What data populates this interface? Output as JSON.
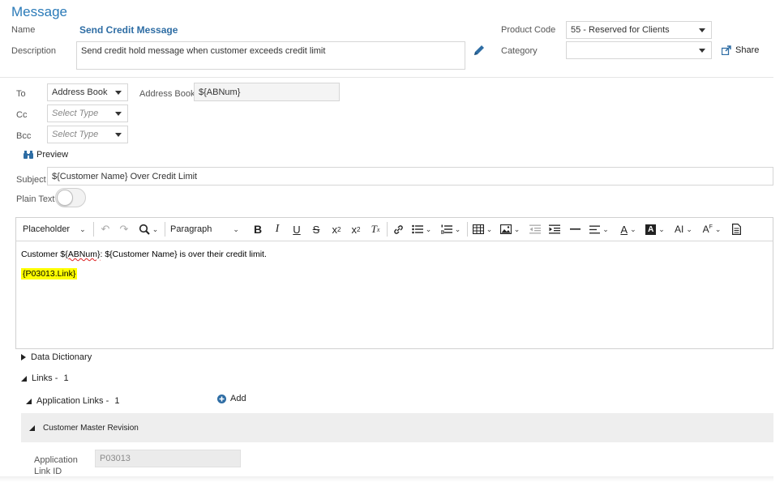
{
  "page": {
    "title": "Message",
    "accent": "#2a7ab8",
    "link_color": "#2e6da4"
  },
  "header": {
    "name_label": "Name",
    "name_value": "Send Credit Message",
    "description_label": "Description",
    "description_value": "Send credit hold message when customer exceeds credit limit",
    "product_code_label": "Product Code",
    "product_code_value": "55 - Reserved for Clients",
    "category_label": "Category",
    "category_value": "",
    "share_label": "Share"
  },
  "recipients": {
    "to_label": "To",
    "to_value": "Address Book",
    "address_book_label": "Address Book",
    "address_book_value": "${ABNum}",
    "cc_label": "Cc",
    "cc_placeholder": "Select Type",
    "bcc_label": "Bcc",
    "bcc_placeholder": "Select Type",
    "preview_label": "Preview"
  },
  "subject": {
    "label": "Subject",
    "value": "${Customer Name} Over Credit Limit",
    "plain_text_label": "Plain Text",
    "plain_text_on": false
  },
  "toolbar": {
    "placeholder_label": "Placeholder",
    "paragraph_label": "Paragraph"
  },
  "editor": {
    "line1_prefix": "Customer $",
    "line1_token": "{ABNum}",
    "line1_suffix": ": ${Customer Name} is over their credit limit.",
    "line2_link": "{P03013.Link}",
    "highlight_color": "#ffff00"
  },
  "sections": {
    "data_dictionary": "Data Dictionary",
    "links_label": "Links -",
    "links_count": "1",
    "app_links_label": "Application Links -",
    "app_links_count": "1",
    "add_label": "Add",
    "customer_master": "Customer Master Revision",
    "app_link_id_label_1": "Application",
    "app_link_id_label_2": "Link ID",
    "app_link_id_value": "P03013"
  }
}
